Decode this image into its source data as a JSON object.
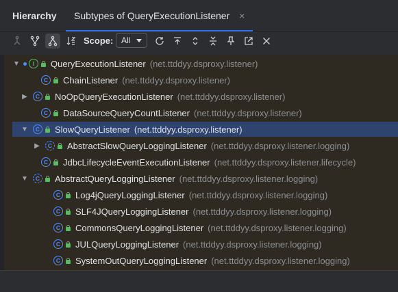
{
  "header": {
    "panel_title": "Hierarchy",
    "tab_label": "Subtypes of QueryExecutionListener",
    "tab_close": "×"
  },
  "toolbar": {
    "scope_label": "Scope:",
    "scope_value": "All"
  },
  "tree": [
    {
      "name": "QueryExecutionListener",
      "package": "(net.ttddyy.dsproxy.listener)",
      "kind": "interface",
      "expanded": true,
      "depth": 0
    },
    {
      "name": "ChainListener",
      "package": "(net.ttddyy.dsproxy.listener)",
      "kind": "class",
      "depth": 1
    },
    {
      "name": "NoOpQueryExecutionListener",
      "package": "(net.ttddyy.dsproxy.listener)",
      "kind": "class",
      "collapsed": true,
      "depth": 1
    },
    {
      "name": "DataSourceQueryCountListener",
      "package": "(net.ttddyy.dsproxy.listener)",
      "kind": "class",
      "depth": 1
    },
    {
      "name": "SlowQueryListener",
      "package": "(net.ttddyy.dsproxy.listener)",
      "kind": "class",
      "expanded": true,
      "selected": true,
      "depth": 1
    },
    {
      "name": "AbstractSlowQueryLoggingListener",
      "package": "(net.ttddyy.dsproxy.listener.logging)",
      "kind": "abstract",
      "collapsed": true,
      "depth": 2
    },
    {
      "name": "JdbcLifecycleEventExecutionListener",
      "package": "(net.ttddyy.dsproxy.listener.lifecycle)",
      "kind": "class",
      "depth": 1
    },
    {
      "name": "AbstractQueryLoggingListener",
      "package": "(net.ttddyy.dsproxy.listener.logging)",
      "kind": "abstract",
      "expanded": true,
      "depth": 1
    },
    {
      "name": "Log4jQueryLoggingListener",
      "package": "(net.ttddyy.dsproxy.listener.logging)",
      "kind": "class",
      "depth": 2
    },
    {
      "name": "SLF4JQueryLoggingListener",
      "package": "(net.ttddyy.dsproxy.listener.logging)",
      "kind": "class",
      "depth": 2
    },
    {
      "name": "CommonsQueryLoggingListener",
      "package": "(net.ttddyy.dsproxy.listener.logging)",
      "kind": "class",
      "depth": 2
    },
    {
      "name": "JULQueryLoggingListener",
      "package": "(net.ttddyy.dsproxy.listener.logging)",
      "kind": "class",
      "depth": 2
    },
    {
      "name": "SystemOutQueryLoggingListener",
      "package": "(net.ttddyy.dsproxy.listener.logging)",
      "kind": "class",
      "depth": 2
    }
  ],
  "colors": {
    "accent": "#3574f0",
    "selection": "#2e436e",
    "class_icon": "#548af7",
    "interface_icon": "#5fb865"
  }
}
